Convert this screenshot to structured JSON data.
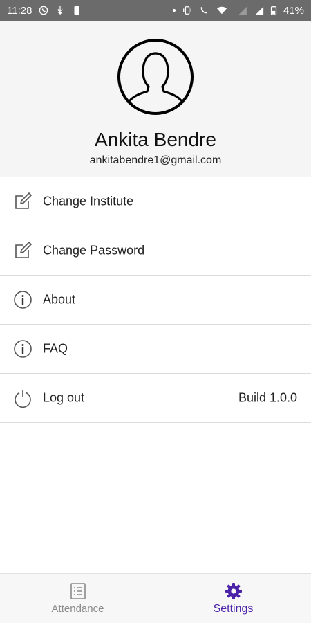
{
  "status_bar": {
    "time": "11:28",
    "battery": "41%",
    "left_icons": [
      "whatsapp-icon",
      "usb-icon",
      "phone-icon"
    ],
    "right_icons": [
      "dot-icon",
      "vibrate-icon",
      "lte-call-icon",
      "wifi-icon",
      "lte-signal-icon",
      "signal-icon",
      "battery-icon"
    ]
  },
  "profile": {
    "avatar_icon": "user-avatar-icon",
    "name": "Ankita Bendre",
    "email": "ankitabendre1@gmail.com"
  },
  "menu": {
    "items": [
      {
        "label": "Change Institute",
        "icon": "edit-icon"
      },
      {
        "label": "Change Password",
        "icon": "edit-icon"
      },
      {
        "label": "About",
        "icon": "info-icon"
      },
      {
        "label": "FAQ",
        "icon": "info-icon"
      },
      {
        "label": "Log out",
        "icon": "power-icon",
        "meta": "Build 1.0.0"
      }
    ]
  },
  "bottom_nav": {
    "tabs": [
      {
        "label": "Attendance",
        "icon": "list-icon",
        "active": false
      },
      {
        "label": "Settings",
        "icon": "gear-icon",
        "active": true
      }
    ]
  },
  "colors": {
    "accent": "#4b23a8",
    "header_bg": "#f4f5f4",
    "status_bar_bg": "#6b6b6b",
    "divider": "#dcdcdc",
    "inactive": "#8a8a8a"
  }
}
